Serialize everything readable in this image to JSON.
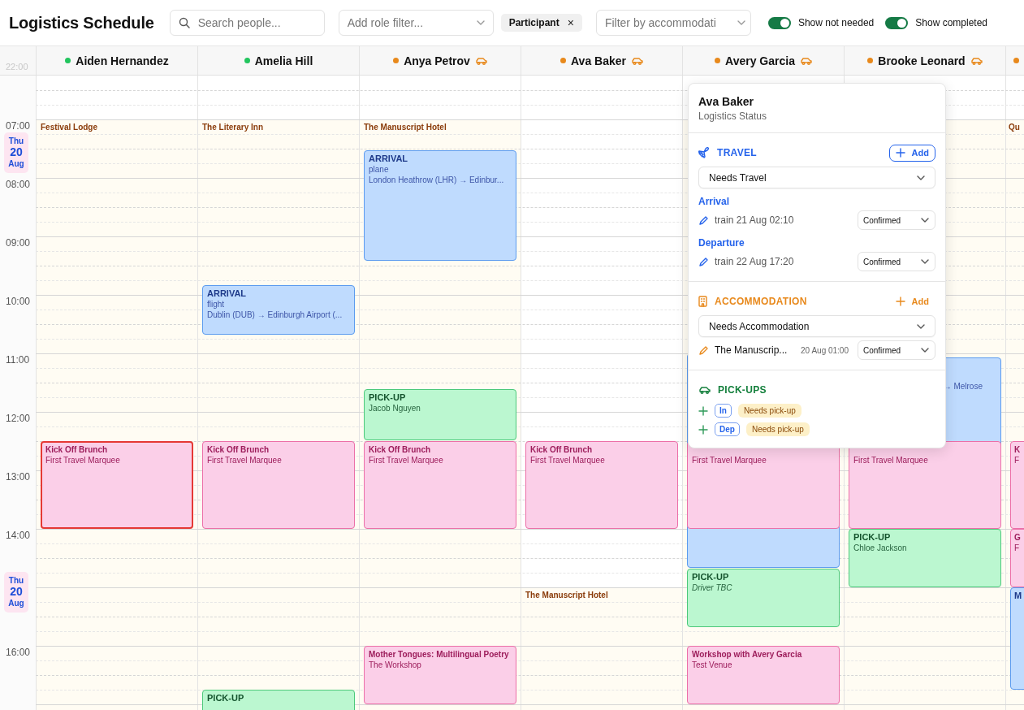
{
  "header": {
    "title": "Logistics Schedule",
    "search": {
      "placeholder": "Search people..."
    },
    "role_filter": {
      "placeholder": "Add role filter..."
    },
    "chips": [
      {
        "label": "Participant",
        "remove": "×"
      }
    ],
    "accommodation_filter": {
      "placeholder": "Filter by accommodati"
    },
    "toggles": [
      {
        "label": "Show not needed",
        "on": true
      },
      {
        "label": "Show completed",
        "on": true
      }
    ]
  },
  "schedule": {
    "corner_time": "22:00",
    "time_labels": [
      "07:00",
      "08:00",
      "09:00",
      "10:00",
      "11:00",
      "12:00",
      "13:00",
      "14:00",
      "16:00"
    ],
    "date_badges": [
      {
        "weekday": "Thu",
        "day": "20",
        "month": "Aug"
      },
      {
        "weekday": "Thu",
        "day": "20",
        "month": "Aug"
      }
    ],
    "people": [
      {
        "name": "Aiden Hernandez",
        "color": "#22c55e",
        "pickup_pending": false,
        "shaded": true,
        "stay_label": "Festival Lodge",
        "events": [
          {
            "kind": "session",
            "title": "Kick Off Brunch",
            "lines": [
              "First Travel Marquee"
            ],
            "highlighted": true
          }
        ]
      },
      {
        "name": "Amelia Hill",
        "color": "#22c55e",
        "pickup_pending": false,
        "shaded": true,
        "stay_label": "The Literary Inn",
        "events": [
          {
            "kind": "arrival",
            "title": "ARRIVAL",
            "lines": [
              "flight",
              "Dublin (DUB) → Edinburgh Airport (..."
            ]
          },
          {
            "kind": "session",
            "title": "Kick Off Brunch",
            "lines": [
              "First Travel Marquee"
            ],
            "highlighted": false
          },
          {
            "kind": "pickup",
            "title": "PICK-UP"
          }
        ]
      },
      {
        "name": "Anya Petrov",
        "color": "#e8891c",
        "pickup_pending": true,
        "shaded": true,
        "stay_label": "The Manuscript Hotel",
        "events": [
          {
            "kind": "arrival",
            "title": "ARRIVAL",
            "lines": [
              "plane",
              "London Heathrow (LHR) → Edinbur..."
            ]
          },
          {
            "kind": "pickup",
            "title": "PICK-UP",
            "lines": [
              "Jacob Nguyen"
            ]
          },
          {
            "kind": "session",
            "title": "Kick Off Brunch",
            "lines": [
              "First Travel Marquee"
            ],
            "highlighted": false
          },
          {
            "kind": "session",
            "title": "Mother Tongues: Multilingual Poetry",
            "lines": [
              "The Workshop"
            ],
            "highlighted": false
          }
        ]
      },
      {
        "name": "Ava Baker",
        "color": "#e8891c",
        "pickup_pending": true,
        "shaded": true,
        "stay_label": "The Manuscript Hotel",
        "events": [
          {
            "kind": "session",
            "title": "Kick Off Brunch",
            "lines": [
              "First Travel Marquee"
            ],
            "highlighted": false
          }
        ]
      },
      {
        "name": "Avery Garcia",
        "color": "#e8891c",
        "pickup_pending": true,
        "shaded": true,
        "events": [
          {
            "kind": "arrival"
          },
          {
            "kind": "session",
            "lines": [
              "First Travel Marquee"
            ]
          },
          {
            "kind": "pickup",
            "title": "PICK-UP",
            "lines": [
              "Driver TBC"
            ],
            "unassigned": true
          },
          {
            "kind": "session",
            "title": "Workshop with Avery Garcia",
            "lines": [
              "Test Venue"
            ],
            "highlighted": false
          }
        ]
      },
      {
        "name": "Brooke Leonard",
        "color": "#e8891c",
        "pickup_pending": true,
        "shaded": true,
        "events": [
          {
            "kind": "arrival",
            "lines": [
              "→ Melrose"
            ]
          },
          {
            "kind": "session",
            "lines": [
              "First Travel Marquee"
            ]
          },
          {
            "kind": "pickup",
            "title": "PICK-UP",
            "lines": [
              "Chloe Jackson"
            ],
            "unassigned": false
          }
        ]
      },
      {
        "color": "#e8891c",
        "shaded": true,
        "stay_label": "Qu",
        "events": [
          {
            "kind": "session",
            "title": "K",
            "lines": [
              "F"
            ]
          },
          {
            "kind": "session",
            "title": "G",
            "lines": [
              "F"
            ]
          },
          {
            "kind": "arrival",
            "title": "M"
          }
        ]
      }
    ]
  },
  "popup": {
    "name": "Ava Baker",
    "subtitle": "Logistics Status",
    "sections": [
      {
        "kind": "travel",
        "title": "TRAVEL",
        "add": {
          "label": "Add",
          "outlined": true
        },
        "status": "Needs Travel",
        "groups": [
          {
            "label": "Arrival",
            "items": [
              {
                "text": "train 21 Aug 02:10",
                "status": "Confirmed"
              }
            ]
          },
          {
            "label": "Departure",
            "items": [
              {
                "text": "train 22 Aug 17:20",
                "status": "Confirmed"
              }
            ]
          }
        ]
      },
      {
        "kind": "accommodation",
        "title": "ACCOMMODATION",
        "add": {
          "label": "Add",
          "outlined": false
        },
        "status": "Needs Accommodation",
        "groups": [
          {
            "items": [
              {
                "text": "The Manuscrip...",
                "date": "20 Aug 01:00",
                "status": "Confirmed"
              }
            ]
          }
        ]
      },
      {
        "kind": "pickups",
        "title": "PICK-UPS",
        "pickups": [
          {
            "direction": "In",
            "status": "Needs pick-up"
          },
          {
            "direction": "Dep",
            "status": "Needs pick-up"
          }
        ]
      }
    ]
  }
}
